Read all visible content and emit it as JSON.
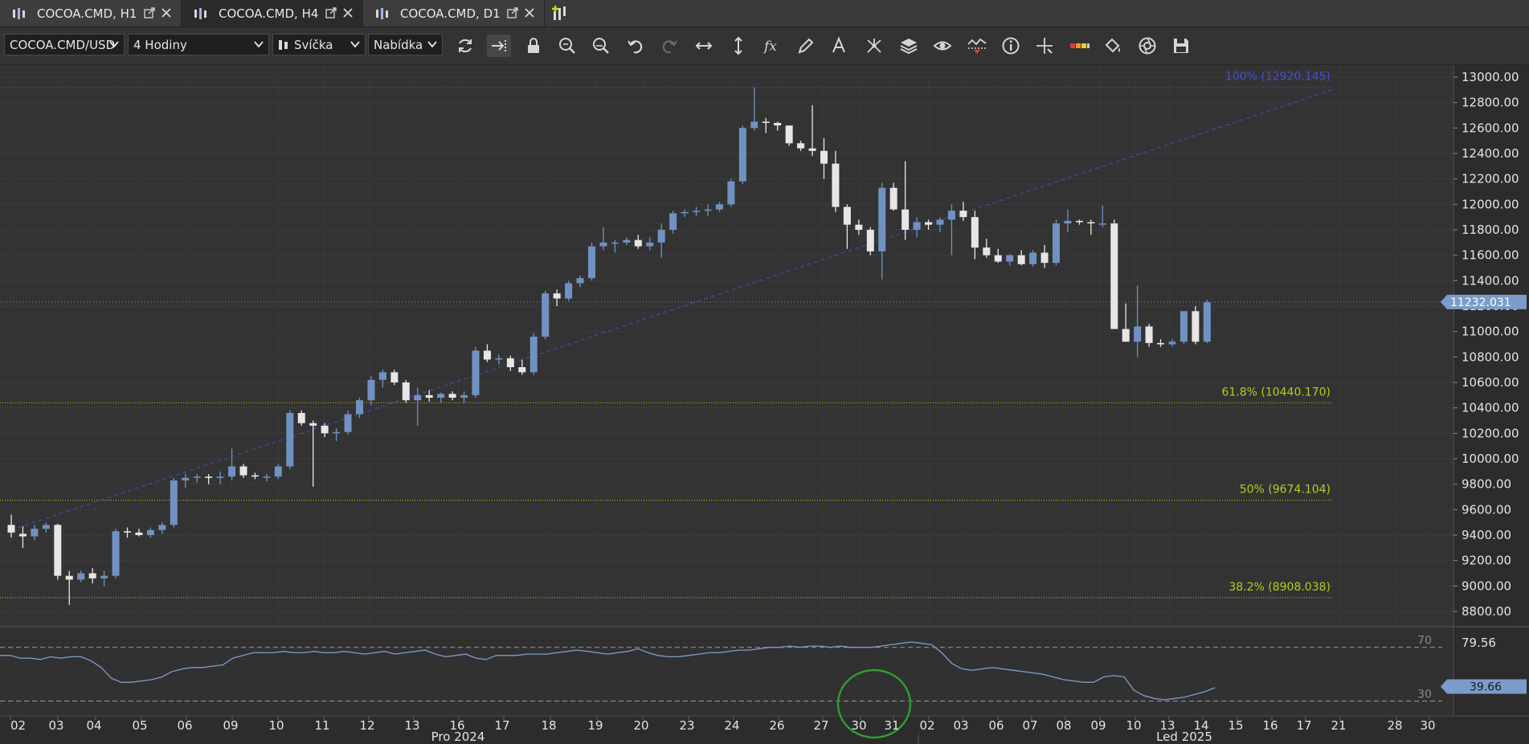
{
  "tabs": [
    {
      "title": "COCOA.CMD, H1",
      "active": false
    },
    {
      "title": "COCOA.CMD, H4",
      "active": true
    },
    {
      "title": "COCOA.CMD, D1",
      "active": false
    }
  ],
  "toolbar": {
    "instrument": "COCOA.CMD/USD",
    "period": "4 Hodiny",
    "chart_type": "Svíčka",
    "offer_side": "Nabídka"
  },
  "colors": {
    "bull_candle": "#7092c2",
    "bear_candle": "#e6e6e6",
    "fib_100": "#4b4bd6",
    "fib_other": "#b5cc1a",
    "price_tag": "#7a9ccc",
    "rsi_line": "#7f9ccc",
    "circle": "#2f9e35"
  },
  "chart_data": {
    "type": "candlestick",
    "y_min": 8700,
    "y_max": 13100,
    "y_ticks": [
      "13000.00",
      "12800.00",
      "12600.00",
      "12400.00",
      "12200.00",
      "12000.00",
      "11800.00",
      "11600.00",
      "11400.00",
      "11200.00",
      "11000.00",
      "10800.00",
      "10600.00",
      "10400.00",
      "10200.00",
      "10000.00",
      "9800.00",
      "9600.00",
      "9400.00",
      "9200.00",
      "9000.00",
      "8800.00"
    ],
    "current_price_label": "11232.031",
    "current_price": 11232.031,
    "fib_levels": [
      {
        "label": "100% (12920.145)",
        "value": 12920.145
      },
      {
        "label": "61.8% (10440.170)",
        "value": 10440.17
      },
      {
        "label": "50% (9674.104)",
        "value": 9674.104
      },
      {
        "label": "38.2% (8908.038)",
        "value": 8908.038
      }
    ],
    "trendline": {
      "from": [
        0,
        9440
      ],
      "to": [
        112,
        12900
      ]
    },
    "candles": [
      [
        9480,
        9560,
        9380,
        9420
      ],
      [
        9410,
        9470,
        9300,
        9390
      ],
      [
        9390,
        9480,
        9360,
        9450
      ],
      [
        9450,
        9500,
        9420,
        9480
      ],
      [
        9480,
        9490,
        9050,
        9080
      ],
      [
        9080,
        9120,
        8850,
        9050
      ],
      [
        9050,
        9120,
        9030,
        9100
      ],
      [
        9100,
        9140,
        9020,
        9060
      ],
      [
        9060,
        9120,
        9000,
        9080
      ],
      [
        9080,
        9450,
        9060,
        9430
      ],
      [
        9430,
        9460,
        9380,
        9420
      ],
      [
        9420,
        9450,
        9390,
        9400
      ],
      [
        9400,
        9460,
        9380,
        9440
      ],
      [
        9440,
        9500,
        9410,
        9480
      ],
      [
        9480,
        9850,
        9460,
        9830
      ],
      [
        9830,
        9880,
        9770,
        9850
      ],
      [
        9850,
        9880,
        9810,
        9860
      ],
      [
        9860,
        9880,
        9800,
        9850
      ],
      [
        9850,
        9900,
        9800,
        9860
      ],
      [
        9860,
        10080,
        9830,
        9940
      ],
      [
        9940,
        9960,
        9850,
        9870
      ],
      [
        9870,
        9890,
        9840,
        9860
      ],
      [
        9860,
        9880,
        9820,
        9860
      ],
      [
        9860,
        9960,
        9840,
        9940
      ],
      [
        9940,
        10380,
        9920,
        10360
      ],
      [
        10360,
        10380,
        10260,
        10280
      ],
      [
        10280,
        10300,
        9780,
        10260
      ],
      [
        10260,
        10280,
        10170,
        10200
      ],
      [
        10200,
        10240,
        10140,
        10210
      ],
      [
        10210,
        10380,
        10190,
        10350
      ],
      [
        10350,
        10480,
        10320,
        10460
      ],
      [
        10460,
        10650,
        10420,
        10620
      ],
      [
        10620,
        10700,
        10560,
        10680
      ],
      [
        10680,
        10700,
        10580,
        10600
      ],
      [
        10600,
        10620,
        10440,
        10460
      ],
      [
        10460,
        10560,
        10260,
        10500
      ],
      [
        10500,
        10540,
        10450,
        10480
      ],
      [
        10480,
        10520,
        10440,
        10510
      ],
      [
        10510,
        10530,
        10460,
        10480
      ],
      [
        10480,
        10530,
        10440,
        10500
      ],
      [
        10500,
        10880,
        10480,
        10850
      ],
      [
        10850,
        10900,
        10760,
        10780
      ],
      [
        10780,
        10820,
        10740,
        10790
      ],
      [
        10790,
        10810,
        10690,
        10720
      ],
      [
        10720,
        10780,
        10660,
        10680
      ],
      [
        10680,
        10990,
        10660,
        10960
      ],
      [
        10960,
        11320,
        10940,
        11300
      ],
      [
        11300,
        11330,
        11200,
        11260
      ],
      [
        11260,
        11400,
        11240,
        11380
      ],
      [
        11380,
        11440,
        11350,
        11420
      ],
      [
        11420,
        11700,
        11400,
        11670
      ],
      [
        11670,
        11820,
        11640,
        11700
      ],
      [
        11700,
        11720,
        11620,
        11700
      ],
      [
        11700,
        11740,
        11680,
        11720
      ],
      [
        11720,
        11760,
        11650,
        11670
      ],
      [
        11670,
        11740,
        11640,
        11700
      ],
      [
        11700,
        11850,
        11580,
        11800
      ],
      [
        11800,
        11950,
        11770,
        11930
      ],
      [
        11930,
        11960,
        11900,
        11940
      ],
      [
        11940,
        11980,
        11910,
        11950
      ],
      [
        11950,
        12000,
        11910,
        11960
      ],
      [
        11960,
        12020,
        11940,
        12000
      ],
      [
        12000,
        12200,
        11980,
        12180
      ],
      [
        12180,
        12620,
        12160,
        12600
      ],
      [
        12600,
        12920,
        12580,
        12650
      ],
      [
        12650,
        12680,
        12560,
        12640
      ],
      [
        12640,
        12650,
        12580,
        12620
      ],
      [
        12620,
        12600,
        12460,
        12480
      ],
      [
        12480,
        12500,
        12420,
        12440
      ],
      [
        12440,
        12780,
        12380,
        12420
      ],
      [
        12420,
        12520,
        12200,
        12320
      ],
      [
        12320,
        12420,
        11940,
        11980
      ],
      [
        11980,
        12000,
        11650,
        11840
      ],
      [
        11840,
        11880,
        11760,
        11800
      ],
      [
        11800,
        11820,
        11600,
        11630
      ],
      [
        11630,
        12170,
        11410,
        12130
      ],
      [
        12130,
        12170,
        11950,
        11960
      ],
      [
        11960,
        12340,
        11720,
        11800
      ],
      [
        11800,
        11900,
        11740,
        11860
      ],
      [
        11860,
        11880,
        11800,
        11840
      ],
      [
        11840,
        11900,
        11780,
        11880
      ],
      [
        11880,
        12000,
        11600,
        11950
      ],
      [
        11950,
        12020,
        11870,
        11900
      ],
      [
        11900,
        11950,
        11570,
        11660
      ],
      [
        11660,
        11730,
        11580,
        11600
      ],
      [
        11600,
        11650,
        11540,
        11550
      ],
      [
        11550,
        11610,
        11520,
        11600
      ],
      [
        11600,
        11640,
        11520,
        11530
      ],
      [
        11530,
        11640,
        11510,
        11620
      ],
      [
        11620,
        11680,
        11500,
        11540
      ],
      [
        11540,
        11880,
        11520,
        11850
      ],
      [
        11850,
        11960,
        11780,
        11870
      ],
      [
        11870,
        11880,
        11840,
        11860
      ],
      [
        11860,
        11880,
        11760,
        11850
      ],
      [
        11850,
        11990,
        11820,
        11850
      ],
      [
        11850,
        11880,
        11040,
        11020
      ],
      [
        11020,
        11220,
        10920,
        10920
      ],
      [
        10920,
        11360,
        10800,
        11040
      ],
      [
        11040,
        11060,
        10880,
        10910
      ],
      [
        10910,
        10940,
        10880,
        10900
      ],
      [
        10900,
        10940,
        10880,
        10920
      ],
      [
        10920,
        11160,
        10900,
        11160
      ],
      [
        11160,
        11200,
        10900,
        10920
      ],
      [
        10920,
        11250,
        10910,
        11230
      ]
    ],
    "rsi": {
      "levels": [
        {
          "label": "70",
          "value": 70
        },
        {
          "label": "30",
          "value": 30
        }
      ],
      "scale_labels": [
        "79.56"
      ],
      "current_label": "39.66",
      "current": 39.66,
      "values": [
        64,
        64,
        62,
        62,
        61,
        63,
        62,
        63,
        63,
        60,
        55,
        47,
        44,
        44,
        45,
        46,
        48,
        52,
        54,
        55,
        55,
        56,
        57,
        62,
        64,
        66,
        66,
        66,
        67,
        66,
        66,
        67,
        66,
        66,
        67,
        66,
        65,
        66,
        67,
        65,
        66,
        67,
        68,
        65,
        63,
        64,
        65,
        62,
        61,
        64,
        64,
        64,
        65,
        65,
        65,
        66,
        67,
        68,
        67,
        66,
        65,
        66,
        67,
        69,
        66,
        64,
        63,
        63,
        64,
        65,
        66,
        66,
        67,
        68,
        68,
        69,
        70,
        70,
        71,
        70,
        71,
        71,
        70,
        71,
        70,
        70,
        70,
        71,
        72,
        73,
        74,
        73,
        72,
        66,
        58,
        54,
        53,
        54,
        55,
        54,
        53,
        52,
        51,
        50,
        48,
        46,
        45,
        44,
        44,
        48,
        49,
        48,
        38,
        34,
        32,
        31,
        32,
        33,
        35,
        37,
        40
      ]
    },
    "x_ticks": [
      "02",
      "03",
      "04",
      "05",
      "06",
      "09",
      "10",
      "11",
      "12",
      "13",
      "16",
      "17",
      "18",
      "19",
      "20",
      "23",
      "24",
      "26",
      "27",
      "30",
      "31",
      "02",
      "03",
      "06",
      "07",
      "08",
      "09",
      "10",
      "13",
      "14",
      "15",
      "16",
      "17",
      "21",
      "28",
      "30"
    ],
    "month_labels": [
      "Pro 2024",
      "Led 2025"
    ]
  }
}
